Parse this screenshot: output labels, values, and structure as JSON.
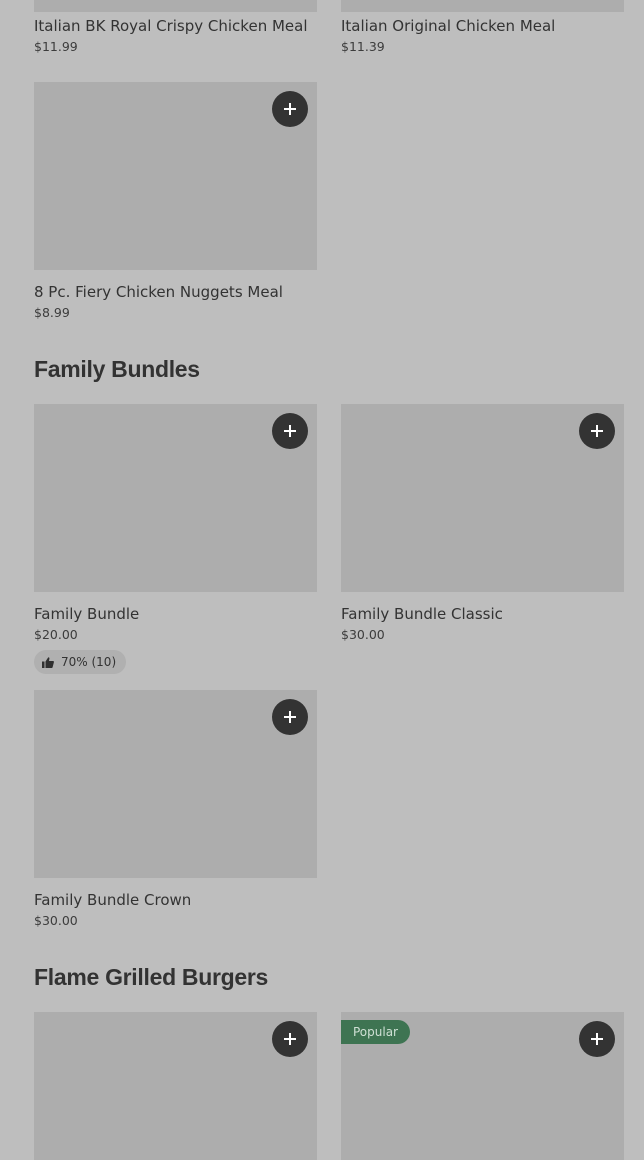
{
  "top_row": [
    {
      "name": "Italian BK Royal Crispy Chicken Meal",
      "price": "$11.99"
    },
    {
      "name": "Italian Original Chicken Meal",
      "price": "$11.39"
    }
  ],
  "chicken_more": [
    {
      "name": "8 Pc. Fiery Chicken Nuggets Meal",
      "price": "$8.99"
    }
  ],
  "family_bundles": {
    "title": "Family Bundles",
    "items": [
      {
        "name": "Family Bundle",
        "price": "$20.00",
        "rating": "70% (10)"
      },
      {
        "name": "Family Bundle Classic",
        "price": "$30.00"
      },
      {
        "name": "Family Bundle Crown",
        "price": "$30.00"
      }
    ]
  },
  "flame_grilled_burgers": {
    "title": "Flame Grilled Burgers",
    "items": [
      {
        "badge": ""
      },
      {
        "badge": "Popular"
      }
    ]
  },
  "icons": {
    "add": "plus-icon",
    "rating": "thumbs-up-icon"
  },
  "colors": {
    "background": "#bebebe",
    "image_placeholder": "#adadad",
    "add_button": "#333333",
    "popular_badge": "#3e7452"
  }
}
